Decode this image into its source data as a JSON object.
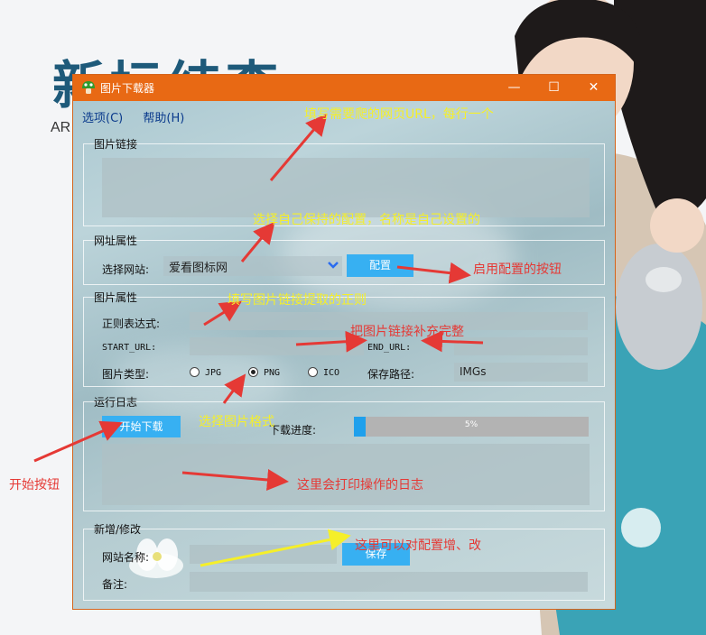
{
  "background": {
    "title": "新坛结李",
    "subtitle": "AR"
  },
  "window": {
    "title": "图片下载器",
    "menu": [
      "选项(C)",
      "帮助(H)"
    ],
    "controls": {
      "minimize": "—",
      "maximize": "☐",
      "close": "✕"
    }
  },
  "groups": {
    "image_links": {
      "label": "图片链接",
      "value": ""
    },
    "site_props": {
      "label": "网址属性",
      "select_label": "选择网站:",
      "select_value": "爱看图标网",
      "config_button": "配置"
    },
    "image_props": {
      "label": "图片属性",
      "regex_label": "正则表达式:",
      "regex_value": "",
      "start_url_label": "START_URL:",
      "start_url_value": "",
      "end_url_label": "END_URL:",
      "end_url_value": "",
      "type_label": "图片类型:",
      "types": [
        "JPG",
        "PNG",
        "ICO"
      ],
      "selected_type": "PNG",
      "save_path_label": "保存路径:",
      "save_path_value": "IMGs"
    },
    "run_log": {
      "label": "运行日志",
      "start_button": "开始下载",
      "progress_label": "下载进度:",
      "progress_text": "5%",
      "progress_value": 0.05,
      "log_text": ""
    },
    "edit": {
      "label": "新增/修改",
      "site_name_label": "网站名称:",
      "site_name_value": "",
      "save_button": "保存",
      "note_label": "备注:",
      "note_value": ""
    }
  },
  "annotations": {
    "fill_url": "填写需要爬的网页URL，每行一个",
    "choose_config": "选择自己保持的配置，名称是自己设置的",
    "apply_config": "启用配置的按钮",
    "fill_regex": "填写图片链接提取的正则",
    "complete_link": "把图片链接补充完整",
    "choose_format": "选择图片格式",
    "start_button": "开始按钮",
    "log_hint": "这里会打印操作的日志",
    "edit_hint": "这里可以对配置增、改"
  },
  "colors": {
    "titlebar": "#e86914",
    "accent_button": "#37b0f2",
    "annotation_yellow": "#f5ef2a",
    "annotation_red": "#e53935"
  }
}
